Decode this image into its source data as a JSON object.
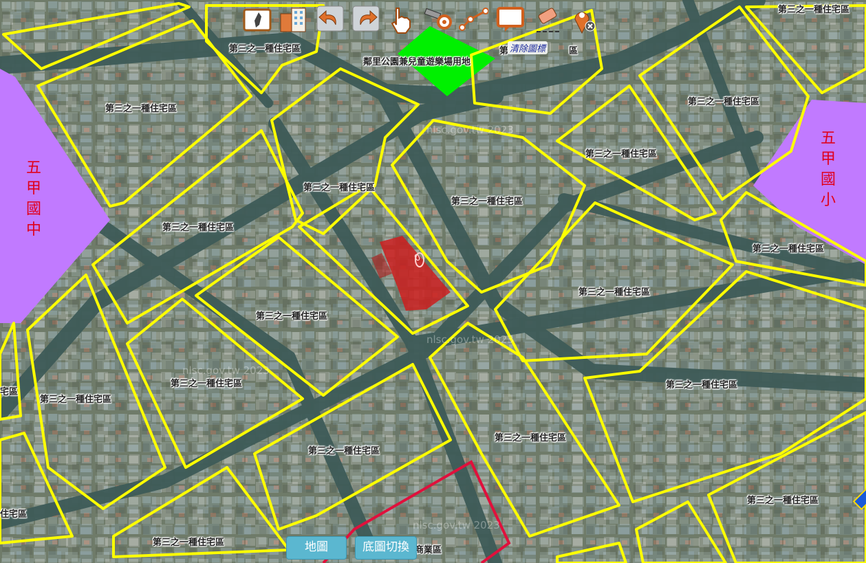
{
  "map": {
    "zones": [
      {
        "id": "z1",
        "label": "第三之一種住宅區"
      },
      {
        "id": "z2",
        "label": "第三之一種住宅區"
      },
      {
        "id": "z3",
        "label": "第三之一種住宅區"
      },
      {
        "id": "z4",
        "label": "第三之一種住宅區"
      },
      {
        "id": "z5",
        "label": "第三之一種住宅區"
      },
      {
        "id": "z6",
        "label": "第三之一種住宅區"
      },
      {
        "id": "z7",
        "label": "第三之一種住宅區"
      },
      {
        "id": "z8",
        "label": "第三之一種住宅區"
      },
      {
        "id": "z9",
        "label": "第三之一種住宅區"
      },
      {
        "id": "z10",
        "label": "第三之一種住宅區"
      },
      {
        "id": "z11",
        "label": "第三之一種住宅區"
      },
      {
        "id": "z12",
        "label": "第三之一種住宅區"
      },
      {
        "id": "z13",
        "label": "第三之一種住宅區"
      },
      {
        "id": "z14",
        "label": "第三之一種住宅區"
      },
      {
        "id": "z15",
        "label": "第三之一種住宅區"
      },
      {
        "id": "z16",
        "label": "第三之一種住宅區"
      },
      {
        "id": "z17",
        "label": "第三之一種住宅區"
      },
      {
        "id": "z18",
        "label": "第三之一種住宅區"
      },
      {
        "id": "z19",
        "label": "宅區"
      },
      {
        "id": "z20",
        "label": "住宅區"
      },
      {
        "id": "z21",
        "label": "第"
      },
      {
        "id": "z22",
        "label": "區"
      }
    ],
    "park_label": "鄰里公園兼兒童遊樂場用地",
    "commercial_label": "商業區",
    "school_left": "五甲國中",
    "school_right": "五甲國小",
    "selected_marker": "0",
    "watermark": "nlsc.gov.tw 2023",
    "colors": {
      "zone_outline": "#ffff00",
      "school_fill": "#c17aff",
      "park_fill": "#00f000",
      "selected_fill": "#cc1f1f",
      "commercial_outline": "#e0103c",
      "school_text": "#e0001a"
    }
  },
  "toolbar": {
    "tools": [
      {
        "icon": "taiwan-map-icon"
      },
      {
        "icon": "buildings-icon"
      },
      {
        "icon": "undo-icon"
      },
      {
        "icon": "redo-icon"
      },
      {
        "icon": "hand-pointer-icon"
      },
      {
        "icon": "ruler-measure-icon"
      },
      {
        "icon": "polyline-measure-icon"
      },
      {
        "icon": "comment-icon"
      },
      {
        "icon": "eraser-icon"
      },
      {
        "icon": "clear-marker-icon"
      }
    ],
    "tooltip": "清除圖標"
  },
  "buttons": {
    "map": "地圖",
    "basemap": "底圖切換"
  }
}
